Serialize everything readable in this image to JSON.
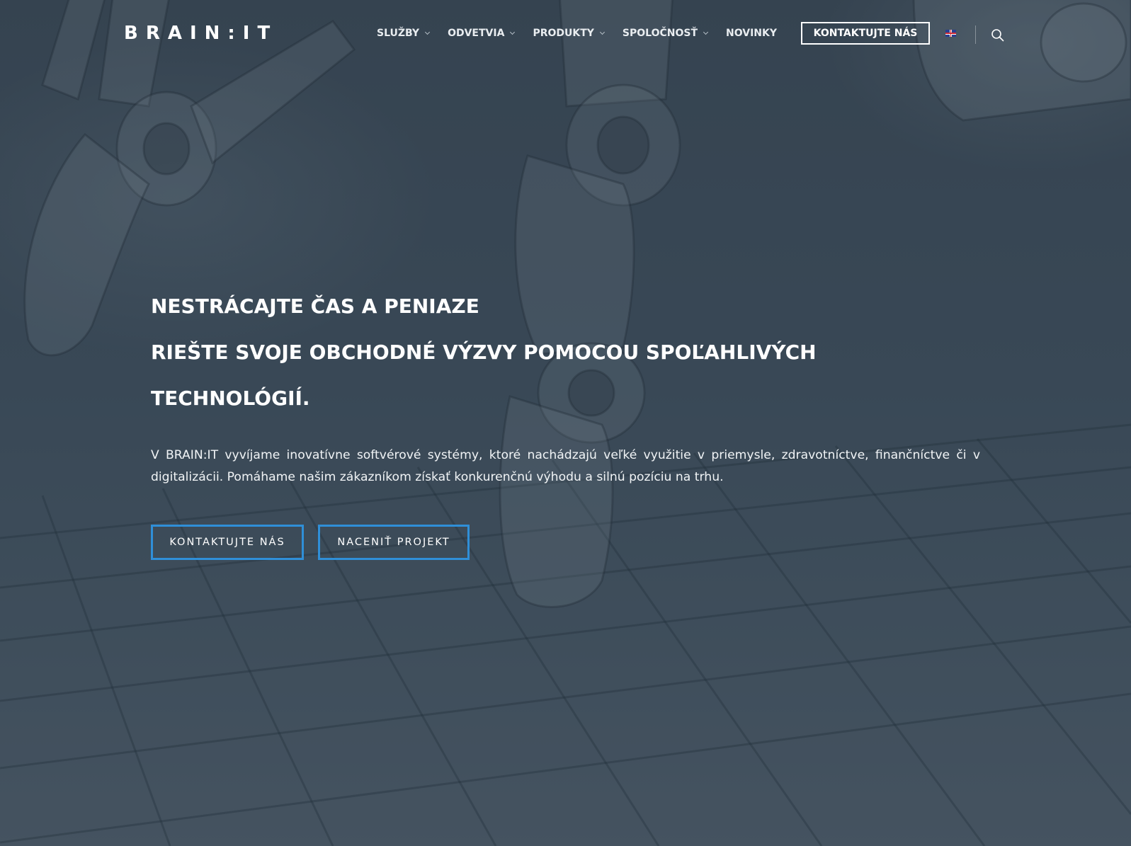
{
  "header": {
    "logo": "BRAIN:IT",
    "nav": [
      {
        "label": "SLUŽBY",
        "has_dropdown": true
      },
      {
        "label": "ODVETVIA",
        "has_dropdown": true
      },
      {
        "label": "PRODUKTY",
        "has_dropdown": true
      },
      {
        "label": "SPOLOČNOSŤ",
        "has_dropdown": true
      },
      {
        "label": "NOVINKY",
        "has_dropdown": false
      }
    ],
    "cta_label": "KONTAKTUJTE NÁS",
    "language_icon": "uk-flag-icon",
    "search_icon": "search-icon"
  },
  "hero": {
    "headline_lines": [
      "NESTRÁCAJTE ČAS A PENIAZE",
      "RIEŠTE SVOJE OBCHODNÉ VÝZVY POMOCOU SPOĽAHLIVÝCH",
      "TECHNOLÓGIÍ."
    ],
    "lead": "V BRAIN:IT vyvíjame inovatívne softvérové systémy, ktoré nachádzajú veľké využitie v priemysle, zdravotníctve, finančníctve či v digitalizácii. Pomáhame našim zákazníkom získať konkurenčnú výhodu a silnú pozíciu na trhu.",
    "buttons": [
      {
        "label": "KONTAKTUJTE NÁS"
      },
      {
        "label": "NACENIŤ PROJEKT"
      }
    ]
  },
  "colors": {
    "button_border": "#2f8fd8",
    "background": "#3c4a56"
  }
}
